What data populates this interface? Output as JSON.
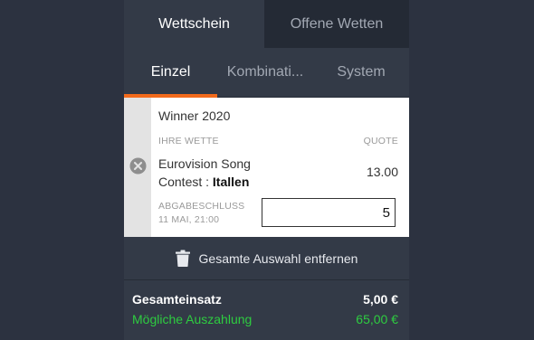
{
  "top_tabs": [
    {
      "label": "Wettschein",
      "active": true
    },
    {
      "label": "Offene Wetten",
      "active": false
    }
  ],
  "sub_tabs": [
    {
      "label": "Einzel",
      "active": true
    },
    {
      "label": "Kombinati...",
      "active": false
    },
    {
      "label": "System",
      "active": false
    }
  ],
  "bet": {
    "event": "Winner 2020",
    "your_bet_label": "IHRE WETTE",
    "odds_label": "QUOTE",
    "selection_line1": "Eurovision Song",
    "selection_line2_prefix": "Contest : ",
    "selection_line2_bold": "Itallen",
    "odds": "13.00",
    "deadline_label": "ABGABESCHLUSS",
    "deadline_value": "11 MAI, 21:00",
    "stake_value": "5"
  },
  "clear_all_label": "Gesamte Auswahl entfernen",
  "summary": {
    "total_stake_label": "Gesamteinsatz",
    "total_stake_value": "5,00 €",
    "payout_label": "Mögliche Auszahlung",
    "payout_value": "65,00 €"
  },
  "colors": {
    "accent": "#f26a1b",
    "payout_green": "#2ecc40",
    "panel_bg": "#333a47",
    "page_bg": "#2c3240"
  },
  "icons": {
    "remove": "close-circle-icon",
    "clear_all": "trash-icon"
  }
}
